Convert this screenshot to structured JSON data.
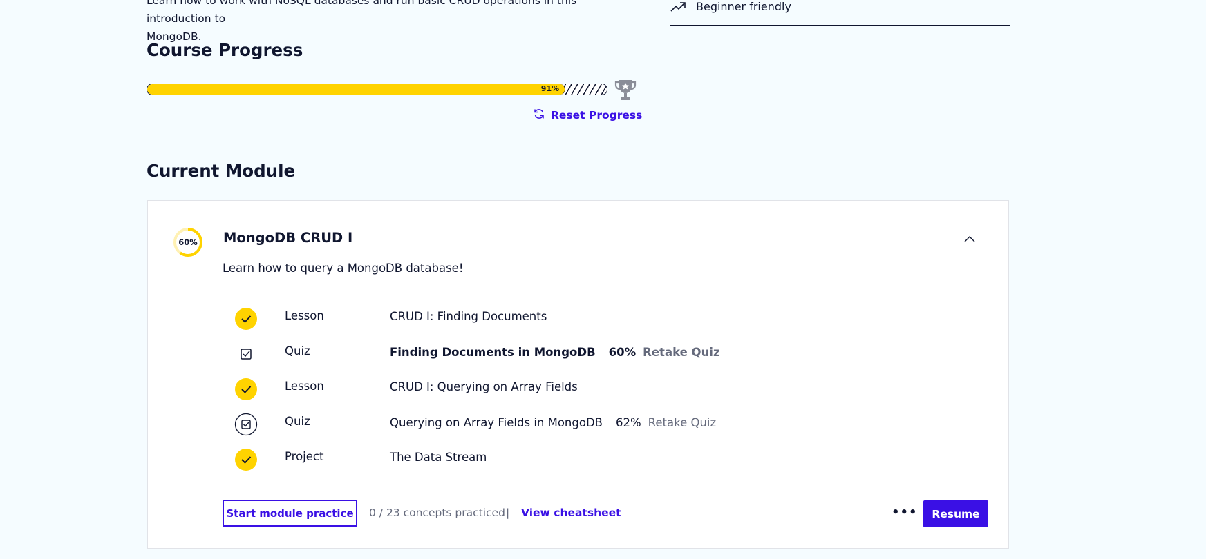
{
  "intro": {
    "line1": "Learn how to work with NoSQL databases and run basic CRUD operations in this introduction to",
    "line2": "MongoDB."
  },
  "sidebar": {
    "difficulty_icon": "trending-up-icon",
    "difficulty_label": "Beginner friendly"
  },
  "course_progress": {
    "heading": "Course Progress",
    "percent": 91,
    "percent_label": "91%",
    "trophy_icon": "trophy-icon",
    "reset_label": "Reset Progress"
  },
  "current_module": {
    "heading": "Current Module",
    "progress_percent": 60,
    "progress_label": "60%",
    "title": "MongoDB CRUD I",
    "description": "Learn how to query a MongoDB database!",
    "items": [
      {
        "status": "complete",
        "kind": "Lesson",
        "name": "CRUD I: Finding Documents"
      },
      {
        "status": "quiz-active",
        "kind": "Quiz",
        "name": "Finding Documents in MongoDB",
        "score": "60%",
        "action": "Retake Quiz"
      },
      {
        "status": "complete",
        "kind": "Lesson",
        "name": "CRUD I: Querying on Array Fields"
      },
      {
        "status": "quiz",
        "kind": "Quiz",
        "name": "Querying on Array Fields in MongoDB",
        "score": "62%",
        "action": "Retake Quiz"
      },
      {
        "status": "complete",
        "kind": "Project",
        "name": "The Data Stream"
      }
    ],
    "footer": {
      "start_practice": "Start module practice",
      "concepts": "0 / 23 concepts practiced",
      "divider": "|",
      "cheatsheet": "View cheatsheet",
      "more": "•••",
      "resume": "Resume"
    }
  },
  "colors": {
    "accent": "#3a10e5",
    "progress": "#ffd300",
    "text": "#10162f",
    "muted": "#656a7c",
    "background": "#f5fcff"
  }
}
